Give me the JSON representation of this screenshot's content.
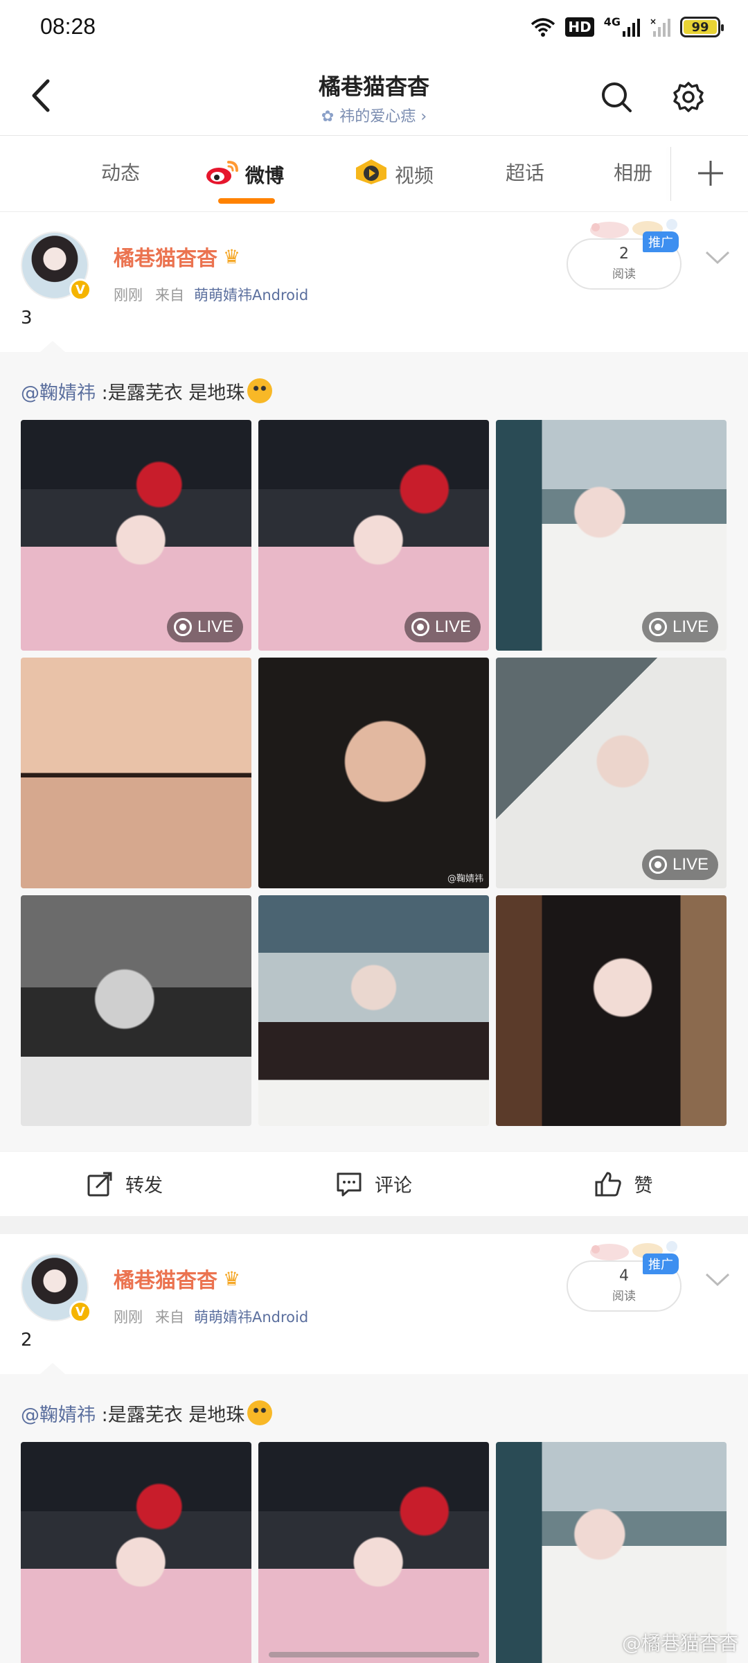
{
  "status": {
    "time": "08:28",
    "hd": "HD",
    "network": "4G",
    "battery": "99"
  },
  "header": {
    "title": "橘巷猫杳杳",
    "subtitle": "祎的爱心痣",
    "subtitle_arrow": "›"
  },
  "tabs": [
    {
      "label": "动态"
    },
    {
      "label": "微博"
    },
    {
      "label": "视频"
    },
    {
      "label": "超话"
    },
    {
      "label": "相册"
    }
  ],
  "posts": [
    {
      "author": "橘巷猫杳杳",
      "time": "刚刚",
      "from_label": "来自",
      "source": "萌萌婧祎Android",
      "read_count": "2",
      "read_label": "阅读",
      "promo": "推广",
      "text": "3",
      "repost_mention": "@鞠婧祎",
      "repost_text": ":是露芜衣  是地珠",
      "images_live": [
        true,
        true,
        true,
        false,
        false,
        true,
        false,
        false,
        false
      ],
      "watermark_on_5": "@鞠婧祎"
    },
    {
      "author": "橘巷猫杳杳",
      "time": "刚刚",
      "from_label": "来自",
      "source": "萌萌婧祎Android",
      "read_count": "4",
      "read_label": "阅读",
      "promo": "推广",
      "text": "2",
      "repost_mention": "@鞠婧祎",
      "repost_text": ":是露芜衣  是地珠"
    }
  ],
  "live_label": "LIVE",
  "actions": {
    "repost": "转发",
    "comment": "评论",
    "like": "赞"
  },
  "bottom_watermark": "@橘巷猫杳杳",
  "colors": {
    "accent": "#ff8200",
    "author": "#eb7350",
    "link": "#5b6f9e",
    "promo": "#3d8ff0"
  }
}
